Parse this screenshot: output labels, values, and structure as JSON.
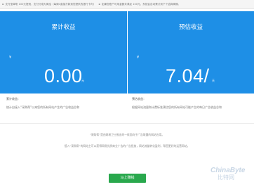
{
  "notice": {
    "items": [
      "支付宝单笔 100元提现，支付分成为周结（每周1直接打款到您提供的银行卡内）",
      "如果您账户可用金额未满足 100元，系统会自动累计到下个结算周期。"
    ]
  },
  "cards": {
    "cumulative": {
      "title": "累计收益",
      "currency": "¥",
      "amount": "0.00",
      "unit": "元"
    },
    "estimated": {
      "title": "预估收益",
      "currency": "¥",
      "amount": "7.04/",
      "unit": "天"
    }
  },
  "descriptions": {
    "cumulative": {
      "head": "累计收益：",
      "body": "统计自接入“采购帮”以来您的所有网站产生的广告收益总和"
    },
    "estimated": {
      "head": "预估收益：",
      "body": "根据网站流量和计费标准预估您的所有网站可能产生的每日广告收益总和"
    }
  },
  "info": {
    "line1": "“采购帮”是由网易卫士推出的一款面向于广告联盟的网站应用。",
    "line2": "接入“采购帮”的网站主可以获得网易优质商业广告的广告投放，网站流量转化盈利，帮您更好的运营网站。"
  },
  "button": {
    "label": "马上赚钱"
  },
  "watermark": {
    "line1": "ChinaByte",
    "line2": "比特网"
  }
}
